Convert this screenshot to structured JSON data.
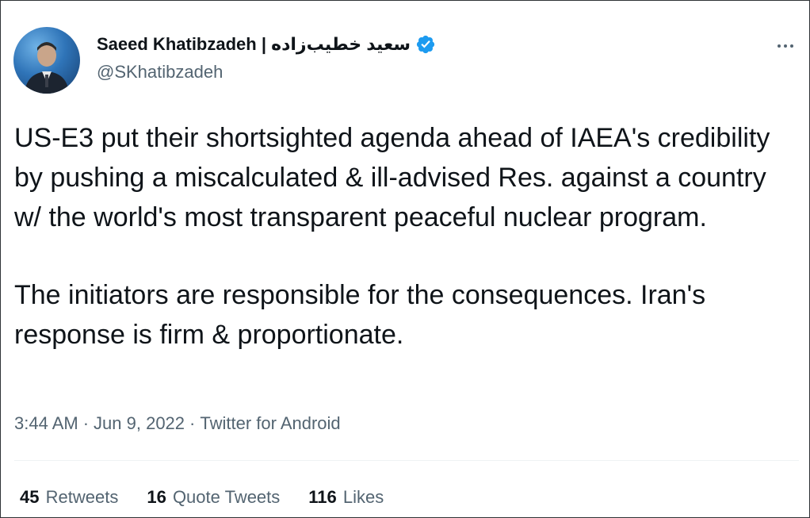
{
  "author": {
    "display_name": "Saeed Khatibzadeh | سعید خطیب‌زاده",
    "handle": "@SKhatibzadeh",
    "verified": true,
    "avatar_icon": "profile-photo"
  },
  "tweet": {
    "paragraphs": [
      "US-E3 put their shortsighted agenda ahead of IAEA's credibility by pushing a miscalculated & ill-advised Res. against a country w/ the world's most transparent peaceful nuclear program.",
      "The initiators are responsible for the consequences. Iran's response is firm & proportionate."
    ],
    "time": "3:44 AM",
    "date": "Jun 9, 2022",
    "source": "Twitter for Android",
    "separator": "·"
  },
  "stats": {
    "retweets": {
      "count": "45",
      "label": "Retweets"
    },
    "quote_tweets": {
      "count": "16",
      "label": "Quote Tweets"
    },
    "likes": {
      "count": "116",
      "label": "Likes"
    }
  },
  "colors": {
    "text": "#0f1419",
    "secondary": "#536471",
    "verified": "#1d9bf0",
    "divider": "#eff3f4"
  }
}
